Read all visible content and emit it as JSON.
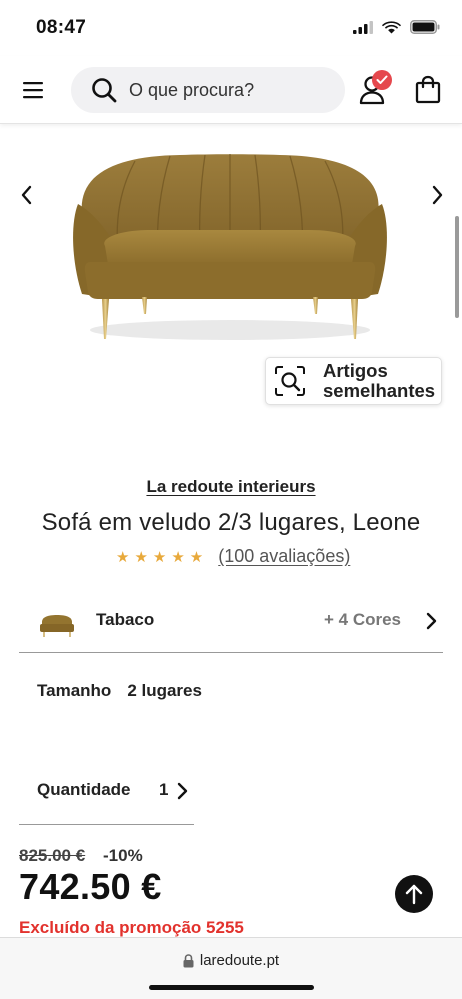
{
  "status_bar": {
    "time": "08:47"
  },
  "header": {
    "search_placeholder": "O que procura?",
    "icons": [
      "menu-icon",
      "search-icon",
      "account-icon",
      "check-badge-icon",
      "shopping-bag-icon"
    ],
    "badge_color": "#e5484d"
  },
  "gallery": {
    "icons": [
      "chevron-left-icon",
      "chevron-right-icon"
    ],
    "image": "velvet sofa in tobacco color with gold legs"
  },
  "similar_button": {
    "label_line1": "Artigos",
    "label_line2": "semelhantes"
  },
  "product": {
    "brand": "La redoute interieurs",
    "title": "Sofá em veludo 2/3 lugares, Leone",
    "rating_stars": 5,
    "reviews_label": "(100 avaliações)",
    "star_color": "#e8a93b"
  },
  "color_selector": {
    "selected": "Tabaco",
    "more": "+ 4 Cores"
  },
  "size": {
    "label": "Tamanho",
    "value": "2 lugares"
  },
  "quantity": {
    "label": "Quantidade",
    "value": "1"
  },
  "pricing": {
    "old_price": "825.00 €",
    "discount": "-10%",
    "price": "742.50 €",
    "excluded_note": "Excluído da promoção 5255",
    "note_color": "#e2322d"
  },
  "browser": {
    "url": "laredoute.pt"
  }
}
